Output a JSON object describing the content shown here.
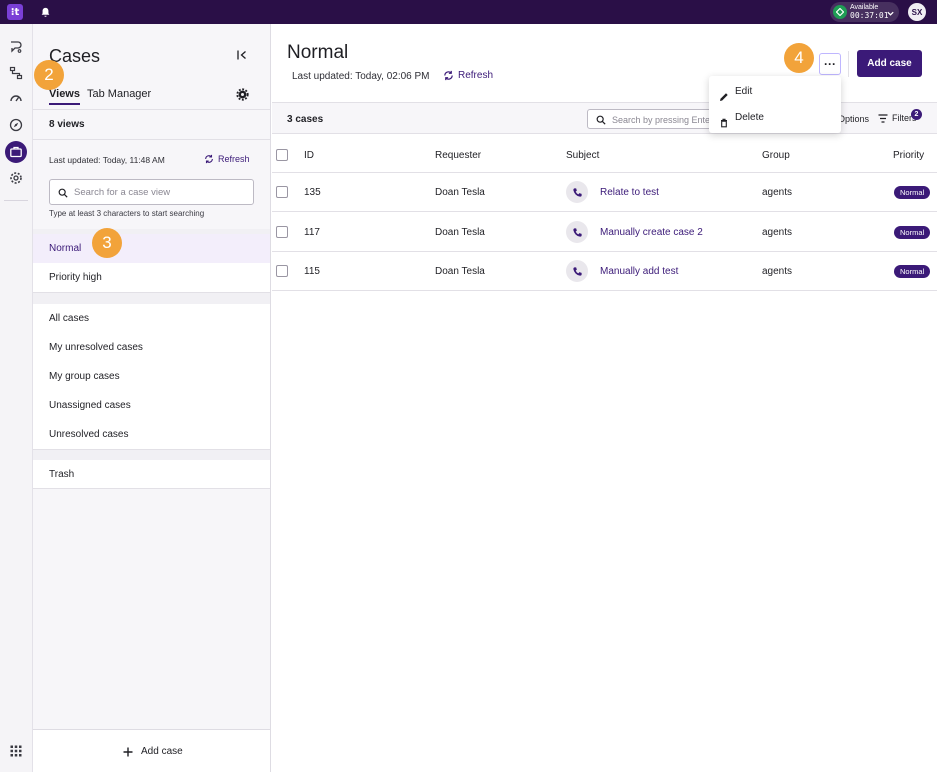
{
  "topbar": {
    "logo": "⁝t",
    "status_label": "Available",
    "status_timer": "00:37:01",
    "avatar_initials": "SX"
  },
  "sidebar": {
    "title": "Cases",
    "tabs": [
      {
        "label": "Views",
        "active": true
      },
      {
        "label": "Tab Manager",
        "active": false
      }
    ],
    "views_count": "8 views",
    "last_updated": "Last updated:  Today, 11:48 AM",
    "refresh_label": "Refresh",
    "search_placeholder": "Search for a case view",
    "search_hint": "Type at least 3 characters to start searching",
    "custom_views": [
      "Normal",
      "Priority high"
    ],
    "system_views": [
      "All cases",
      "My unresolved cases",
      "My group cases",
      "Unassigned cases",
      "Unresolved cases"
    ],
    "trash_label": "Trash",
    "add_case_label": "Add case"
  },
  "main": {
    "title": "Normal",
    "last_updated": "Last updated:  Today, 02:06 PM",
    "refresh_label": "Refresh",
    "more_label": "···",
    "add_case_label": "Add case",
    "case_count": "3 cases",
    "search_placeholder": "Search by pressing Enter",
    "options_label": "Options",
    "filters_label": "Filters",
    "filters_count": "2",
    "menu": [
      "Edit",
      "Delete"
    ],
    "columns": [
      "ID",
      "Requester",
      "Subject",
      "Group",
      "Priority"
    ],
    "rows": [
      {
        "id": "135",
        "requester": "Doan Tesla",
        "subject": "Relate to test",
        "group": "agents",
        "priority": "Normal"
      },
      {
        "id": "117",
        "requester": "Doan Tesla",
        "subject": "Manually create case 2",
        "group": "agents",
        "priority": "Normal"
      },
      {
        "id": "115",
        "requester": "Doan Tesla",
        "subject": "Manually add test",
        "group": "agents",
        "priority": "Normal"
      }
    ]
  },
  "callouts": [
    "2",
    "3",
    "4"
  ],
  "colors": {
    "brand": "#3b1a78",
    "topbar": "#2a0f47",
    "callout": "#f2a33a",
    "status_green": "#1f9d55"
  }
}
